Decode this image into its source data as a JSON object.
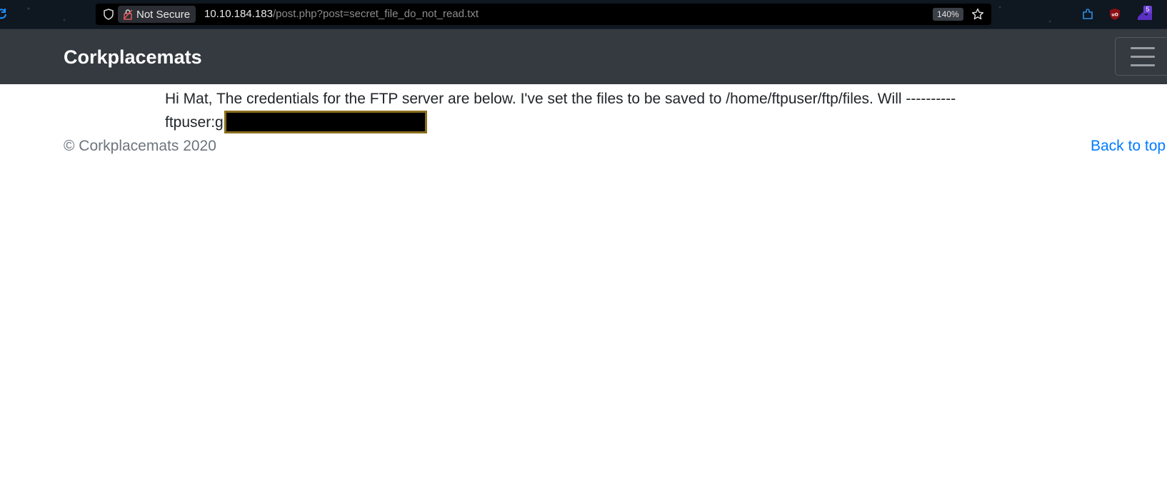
{
  "browser": {
    "not_secure_label": "Not Secure",
    "url_host": "10.10.184.183",
    "url_path": "/post.php?post=secret_file_do_not_read.txt",
    "zoom": "140%",
    "extension_badge": "5"
  },
  "navbar": {
    "brand": "Corkplacemats"
  },
  "post": {
    "line1": "Hi Mat, The credentials for the FTP server are below. I've set the files to be saved to /home/ftpuser/ftp/files. Will ----------",
    "line2_prefix": "ftpuser:g"
  },
  "footer": {
    "copyright": "© Corkplacemats 2020",
    "back_to_top": "Back to top"
  },
  "colors": {
    "navbar_bg": "#343a40",
    "link": "#007bff",
    "muted": "#6c757d",
    "redaction_border": "#8a6d1e"
  }
}
